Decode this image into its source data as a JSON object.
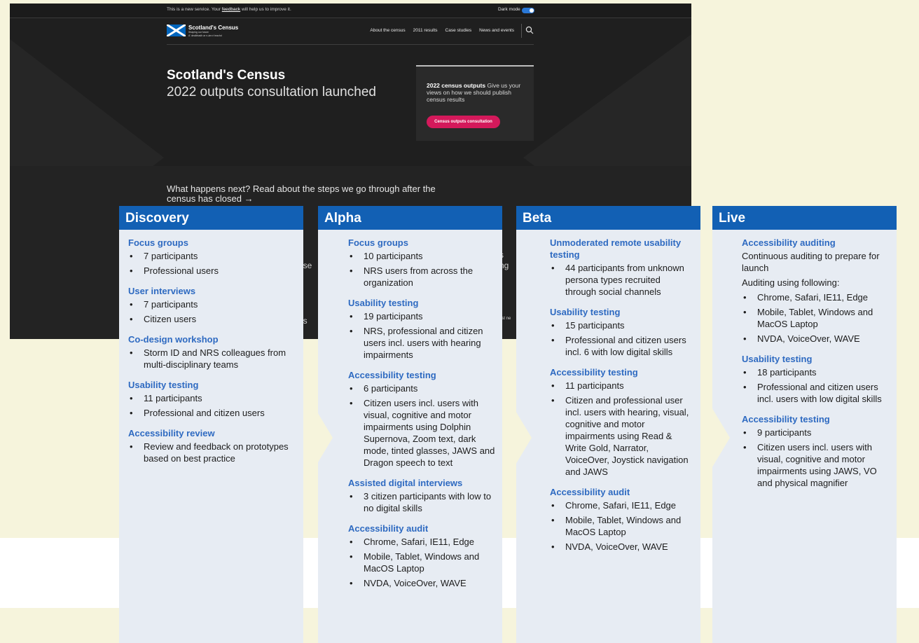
{
  "site": {
    "banner": {
      "text": "This is a new service. Your",
      "link": "feedback",
      "tail": "will help us to improve it.",
      "dark_mode_label": "Dark mode",
      "dark_mode_on": true
    },
    "brand": {
      "name": "Scotland's Census",
      "tagline_1": "Shaping our future",
      "tagline_2": "A' dealbhadh ar n-àm ri teachd"
    },
    "nav": [
      "About the census",
      "2011 results",
      "Case studies",
      "News and events"
    ],
    "hero": {
      "title": "Scotland's Census",
      "subtitle": "2022 outputs consultation launched"
    },
    "card": {
      "bold": "2022 census outputs",
      "text": "Give us your views on how we should publish census results",
      "cta": "Census outputs consultation"
    },
    "next_link": "What happens next? Read about the steps we go through after the census has closed →",
    "fragments": {
      "f1": "nse",
      "f2": "s",
      "f3": "ng",
      "f4": "nd's",
      "f5": "est ne"
    }
  },
  "phases": [
    {
      "name": "Discovery",
      "sections": [
        {
          "title": "Focus groups",
          "items": [
            "7 participants",
            "Professional users"
          ]
        },
        {
          "title": "User interviews",
          "items": [
            "7 participants",
            "Citizen users"
          ]
        },
        {
          "title": "Co-design workshop",
          "items": [
            "Storm ID and NRS colleagues from multi-disciplinary teams"
          ]
        },
        {
          "title": "Usability testing",
          "items": [
            "11 participants",
            "Professional and citizen users"
          ]
        },
        {
          "title": "Accessibility review",
          "items": [
            "Review and feedback on prototypes based on best practice"
          ]
        }
      ]
    },
    {
      "name": "Alpha",
      "sections": [
        {
          "title": "Focus groups",
          "items": [
            "10 participants",
            "NRS users from across the organization"
          ]
        },
        {
          "title": "Usability testing",
          "items": [
            "19 participants",
            "NRS, professional and citizen users incl. users with hearing impairments"
          ]
        },
        {
          "title": "Accessibility testing",
          "items": [
            "6 participants",
            "Citizen users incl. users with visual, cognitive and motor impairments using Dolphin Supernova, Zoom text, dark mode, tinted glasses, JAWS and Dragon speech to text"
          ]
        },
        {
          "title": "Assisted digital interviews",
          "items": [
            "3 citizen participants with low to no digital skills"
          ]
        },
        {
          "title": "Accessibility audit",
          "items": [
            "Chrome, Safari, IE11, Edge",
            "Mobile, Tablet, Windows and MacOS Laptop",
            "NVDA, VoiceOver, WAVE"
          ]
        }
      ]
    },
    {
      "name": "Beta",
      "sections": [
        {
          "title": "Unmoderated remote usability testing",
          "items": [
            "44 participants from unknown persona types recruited through social channels"
          ]
        },
        {
          "title": "Usability testing",
          "items": [
            "15 participants",
            "Professional and citizen users incl. 6 with low digital skills"
          ]
        },
        {
          "title": "Accessibility testing",
          "items": [
            "11 participants",
            "Citizen and professional user incl. users with hearing, visual, cognitive and motor impairments using Read & Write Gold, Narrator, VoiceOver, Joystick navigation and JAWS"
          ]
        },
        {
          "title": "Accessibility audit",
          "items": [
            "Chrome, Safari, IE11, Edge",
            "Mobile, Tablet, Windows and MacOS Laptop",
            "NVDA, VoiceOver, WAVE"
          ]
        }
      ]
    },
    {
      "name": "Live",
      "sections": [
        {
          "title": "Accessibility auditing",
          "paras": [
            "Continuous auditing to prepare for launch",
            "Auditing using following:"
          ],
          "items": [
            "Chrome, Safari, IE11, Edge",
            "Mobile, Tablet, Windows and MacOS Laptop",
            "NVDA, VoiceOver, WAVE"
          ]
        },
        {
          "title": "Usability testing",
          "items": [
            "18 participants",
            "Professional and citizen users incl. users with low digital skills"
          ]
        },
        {
          "title": "Accessibility testing",
          "items": [
            "9 participants",
            "Citizen users incl. users with visual, cognitive and motor impairments using JAWS, VO and physical magnifier"
          ]
        }
      ]
    }
  ],
  "colors": {
    "phase_header": "#1260b4",
    "section_title": "#2e6ac1",
    "cta": "#d4195b",
    "toggle": "#2a78d6"
  }
}
